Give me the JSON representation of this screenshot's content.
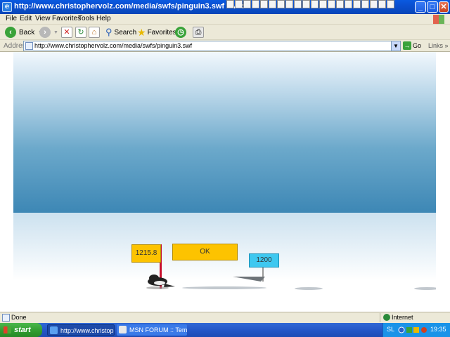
{
  "window": {
    "title": "http://www.christophervolz.com/media/swfs/pinguin3.swf - Microsoft Internet Explorer"
  },
  "menu": [
    "File",
    "Edit",
    "View",
    "Favorites",
    "Tools",
    "Help"
  ],
  "toolbar": {
    "back_label": "Back",
    "search_label": "Search",
    "favorites_label": "Favorites"
  },
  "address": {
    "label": "Address",
    "url": "http://www.christophervolz.com/media/swfs/pinguin3.swf",
    "go_label": "Go",
    "links_label": "Links"
  },
  "game": {
    "distance_label": "1215.8",
    "ok_label": "OK",
    "target_label": "1200"
  },
  "status": {
    "text": "Done",
    "zone": "Internet"
  },
  "taskbar": {
    "start_label": "start",
    "tasks": [
      "http://www.christoph...",
      "MSN FORUM :: Tema ..."
    ],
    "language": "SL",
    "clock": "19:35"
  },
  "colors": {
    "sign_orange": "#fdc300",
    "sign_blue": "#3ec8f0",
    "flag_red": "#c8102e"
  }
}
